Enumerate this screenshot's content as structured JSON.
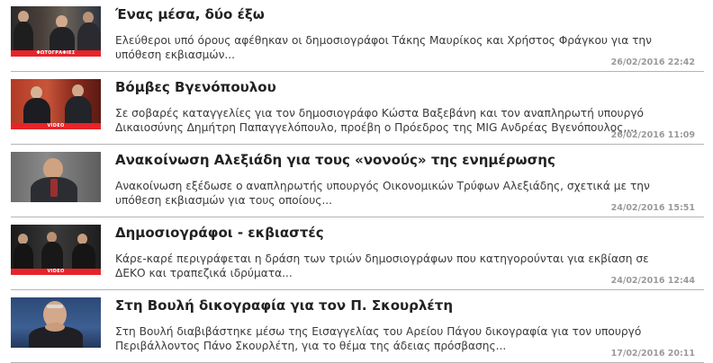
{
  "articles": [
    {
      "title": "Ένας μέσα, δύο έξω",
      "summary": "Ελεύθεροι υπό όρους αφέθηκαν οι δημοσιογράφοι Τάκης Μαυρίκος και Χρήστος Φράγκου για την υπόθεση εκβιασμών...",
      "date": "26/02/2016 22:42",
      "thumb_tag": "ΦΩΤΟΓΡΑΦΙΕΣ"
    },
    {
      "title": "Βόμβες Βγενόπουλου",
      "summary": "Σε σοβαρές καταγγελίες για τον δημοσιογράφο Κώστα Βαξεβάνη και τον αναπληρωτή υπουργό Δικαιοσύνης Δημήτρη Παπαγγελόπουλο, προέβη ο Πρόεδρος της MIG Ανδρέας Βγενόπουλος,...",
      "date": "26/02/2016 11:09",
      "thumb_tag": "VIDEO"
    },
    {
      "title": "Ανακοίνωση Αλεξιάδη για τους «νονούς» της ενημέρωσης",
      "summary": "Ανακοίνωση εξέδωσε ο αναπληρωτής υπουργός Οικονομικών Τρύφων Αλεξιάδης, σχετικά με την υπόθεση εκβιασμών για τους οποίους...",
      "date": "24/02/2016 15:51",
      "thumb_tag": ""
    },
    {
      "title": "Δημοσιογράφοι - εκβιαστές",
      "summary": "Κάρε-καρέ περιγράφεται η δράση των τριών δημοσιογράφων που κατηγορούνται για εκβίαση σε ΔΕΚΟ και τραπεζικά ιδρύματα...",
      "date": "24/02/2016 12:44",
      "thumb_tag": "VIDEO"
    },
    {
      "title": "Στη Βουλή δικογραφία για τον Π. Σκουρλέτη",
      "summary": "Στη Βουλή διαβιβάστηκε μέσω της Εισαγγελίας του Αρείου Πάγου δικογραφία για τον υπουργό Περιβάλλοντος Πάνο Σκουρλέτη, για το θέμα της άδειας πρόσβασης...",
      "date": "17/02/2016 20:11",
      "thumb_tag": ""
    }
  ],
  "colors": {
    "tag_red": "#e8232a",
    "title": "#222222",
    "summary": "#3a3a3a",
    "date": "#9a9a9a",
    "divider": "#b4b4b4"
  }
}
